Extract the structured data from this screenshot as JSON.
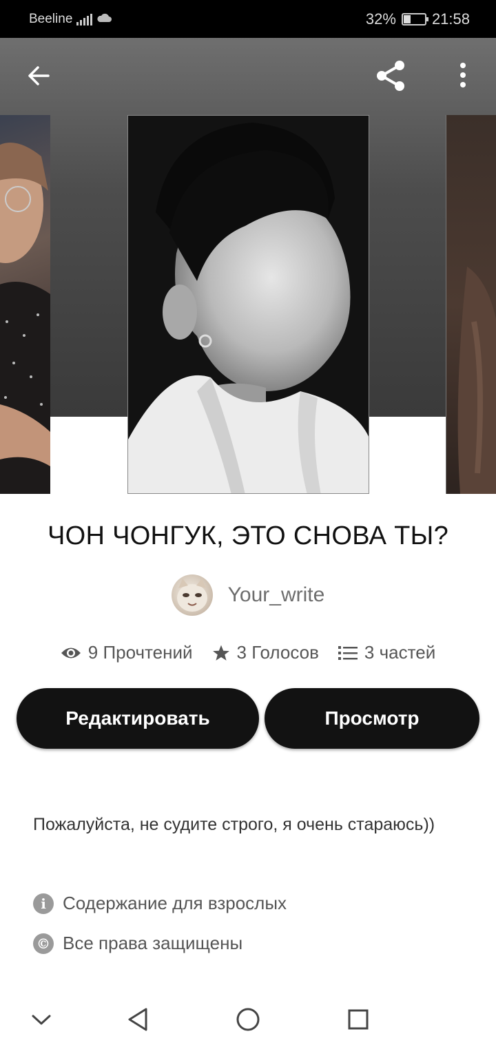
{
  "status_bar": {
    "carrier": "Beeline",
    "battery": "32%",
    "battery_level": 0.32,
    "time": "21:58"
  },
  "toolbar": {
    "back_icon": "arrow-left-icon",
    "share_icon": "share-icon",
    "more_icon": "more-vertical-icon"
  },
  "book": {
    "title": "ЧОН ЧОНГУК,  ЭТО СНОВА ТЫ?",
    "author": "Your_write",
    "stats": {
      "reads": "9 Прочтений",
      "votes": "3 Голосов",
      "parts": "3 частей"
    },
    "description": "Пожалуйста, не судите строго, я очень стараюсь))",
    "mature": "Содержание для взрослых",
    "copyright": "Все права защищены"
  },
  "actions": {
    "edit": "Редактировать",
    "preview": "Просмотр"
  },
  "nav": {
    "icons": [
      "chevron-down-icon",
      "back-triangle-icon",
      "home-circle-icon",
      "recents-square-icon"
    ]
  }
}
